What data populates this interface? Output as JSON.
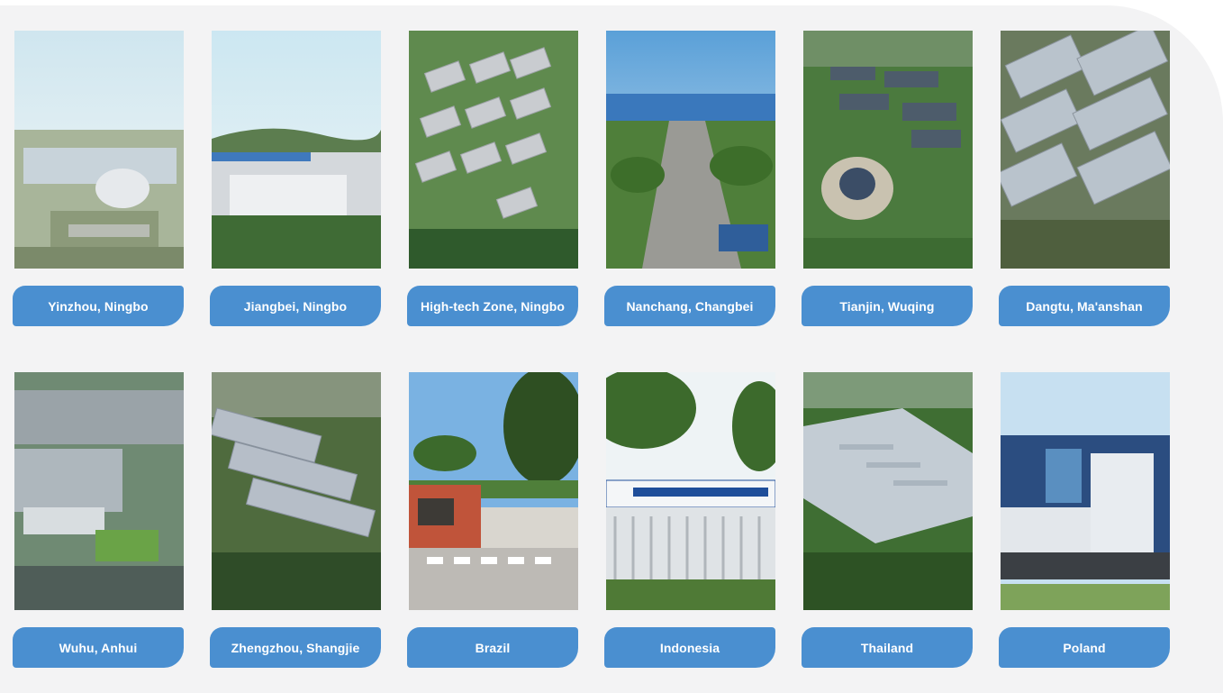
{
  "locations": [
    {
      "name": "Yinzhou, Ningbo",
      "scene": "campus"
    },
    {
      "name": "Jiangbei, Ningbo",
      "scene": "factory-hills"
    },
    {
      "name": "High-tech Zone, Ningbo",
      "scene": "blocks"
    },
    {
      "name": "Nanchang, Changbei",
      "scene": "road"
    },
    {
      "name": "Tianjin, Wuqing",
      "scene": "park"
    },
    {
      "name": "Dangtu, Ma'anshan",
      "scene": "solar"
    },
    {
      "name": "Wuhu, Anhui",
      "scene": "city-factory"
    },
    {
      "name": "Zhengzhou, Shangjie",
      "scene": "sheds"
    },
    {
      "name": "Brazil",
      "scene": "gate"
    },
    {
      "name": "Indonesia",
      "scene": "fence"
    },
    {
      "name": "Thailand",
      "scene": "roof"
    },
    {
      "name": "Poland",
      "scene": "office"
    }
  ],
  "colors": {
    "label_bg": "#4a8fd0",
    "label_text": "#ffffff",
    "panel_bg": "#f3f3f4"
  }
}
